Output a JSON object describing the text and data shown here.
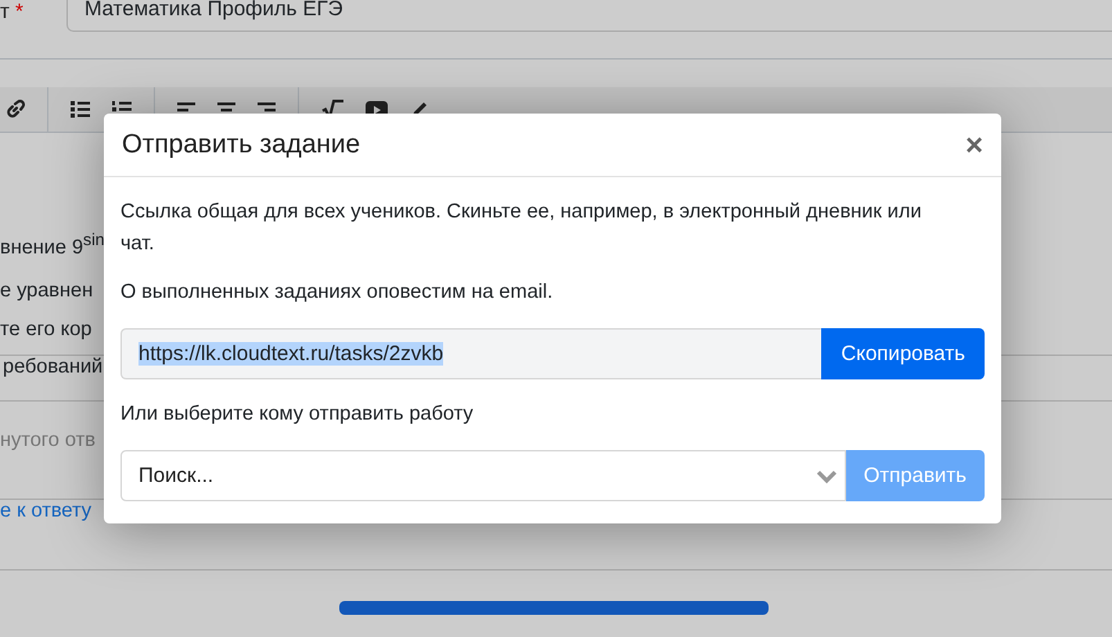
{
  "background": {
    "subject_label": "т",
    "required_mark": "*",
    "subject_value": "Математика Профиль ЕГЭ",
    "lines": [
      "внение 9$^{sin}$",
      "е уравнен",
      "те его кор"
    ],
    "requirements": "ребований",
    "answer_hint": "нутого отв",
    "answer_link": "е к ответу"
  },
  "modal": {
    "title": "Отправить задание",
    "close": "×",
    "note": "Ссылка общая для всех учеников. Скиньте ее, например, в электронный дневник или чат.",
    "email_note": "О выполненных заданиях оповестим на email.",
    "link": {
      "value": "https://lk.cloudtext.ru/tasks/2zvkb",
      "selected": true
    },
    "copy_button": "Скопировать",
    "choose_label": "Или выберите кому отправить работу",
    "search": {
      "placeholder": "Поиск..."
    },
    "send_button": {
      "label": "Отправить",
      "disabled": true
    }
  }
}
